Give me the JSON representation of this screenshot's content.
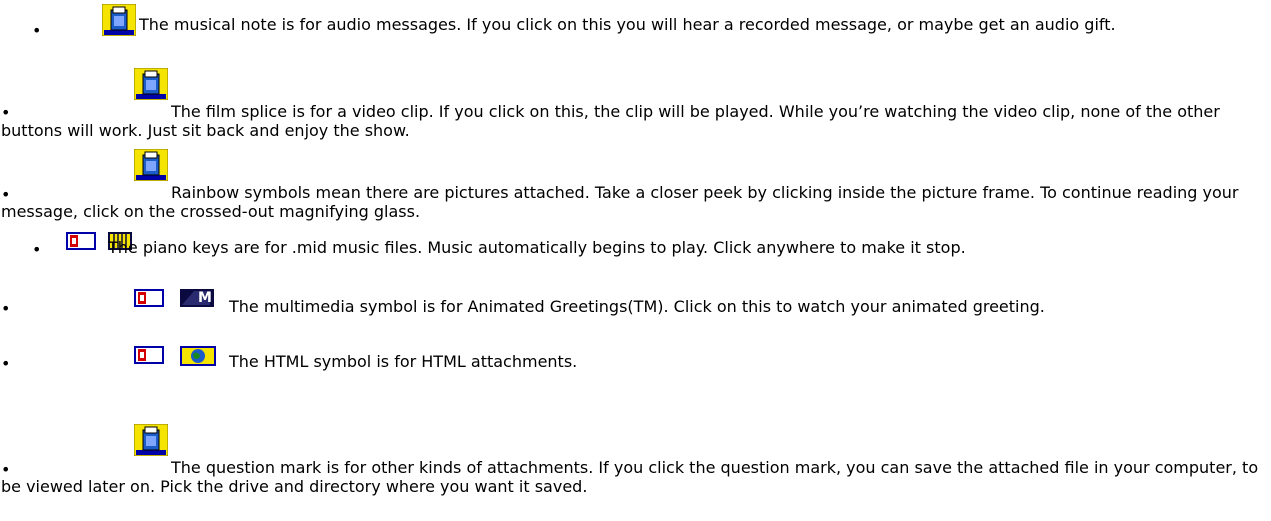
{
  "items": [
    {
      "icon": "musical-note-icon",
      "text": "The musical note is for audio messages. If you click on this you will hear a recorded message, or maybe get an audio gift."
    },
    {
      "icon": "film-splice-icon",
      "text": "The film splice is for a video clip. If you click on this, the clip will be played. While you’re watching the video clip, none of the other buttons will work. Just sit back and enjoy the show."
    },
    {
      "icon": "rainbow-icon",
      "text": "Rainbow symbols mean there are pictures attached. Take a closer peek by clicking inside the picture frame. To continue reading your message, click on the crossed-out magnifying glass."
    },
    {
      "icon": "piano-keys-icon",
      "text": "The piano keys are for .mid music files. Music automatically begins to play. Click anywhere to make it stop."
    },
    {
      "icon": "multimedia-icon",
      "icon_letter": "M",
      "text": "The multimedia symbol is for Animated Greetings(TM). Click on this to watch your animated greeting."
    },
    {
      "icon": "html-globe-icon",
      "text": "The HTML symbol is for HTML attachments."
    },
    {
      "icon": "question-mark-icon",
      "text": "The question mark is for other kinds of attachments. If you click the question mark, you can save the attached file in your computer, to be viewed later on. Pick the drive and directory where you want it saved."
    }
  ],
  "bullet": "•",
  "colors": {
    "icon_yellow": "#f5e400",
    "icon_blue": "#0000a8",
    "icon_red": "#d40000",
    "icon_dark": "#0a0a40"
  }
}
